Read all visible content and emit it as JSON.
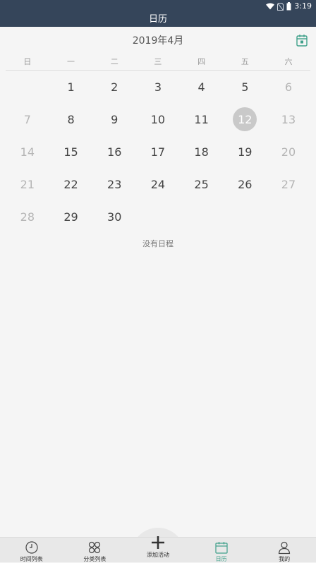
{
  "status": {
    "time": "3:19"
  },
  "app_title": "日历",
  "calendar": {
    "month_title": "2019年4月",
    "weekdays": [
      "日",
      "一",
      "二",
      "三",
      "四",
      "五",
      "六"
    ],
    "weeks": [
      [
        "",
        "1",
        "2",
        "3",
        "4",
        "5",
        "6"
      ],
      [
        "7",
        "8",
        "9",
        "10",
        "11",
        "12",
        "13"
      ],
      [
        "14",
        "15",
        "16",
        "17",
        "18",
        "19",
        "20"
      ],
      [
        "21",
        "22",
        "23",
        "24",
        "25",
        "26",
        "27"
      ],
      [
        "28",
        "29",
        "30",
        "",
        "",
        "",
        ""
      ]
    ],
    "selected_day": "12",
    "empty_message": "没有日程"
  },
  "nav": {
    "items": [
      {
        "label": "时间列表",
        "icon": "clock-icon"
      },
      {
        "label": "分类列表",
        "icon": "category-icon"
      },
      {
        "label": "添加活动",
        "icon": "plus-icon"
      },
      {
        "label": "日历",
        "icon": "calendar-icon"
      },
      {
        "label": "我的",
        "icon": "person-icon"
      }
    ],
    "active_index": 3
  },
  "colors": {
    "header_bg": "#35455a",
    "accent": "#3fa08a",
    "selected_circle": "#c9c9c9"
  }
}
